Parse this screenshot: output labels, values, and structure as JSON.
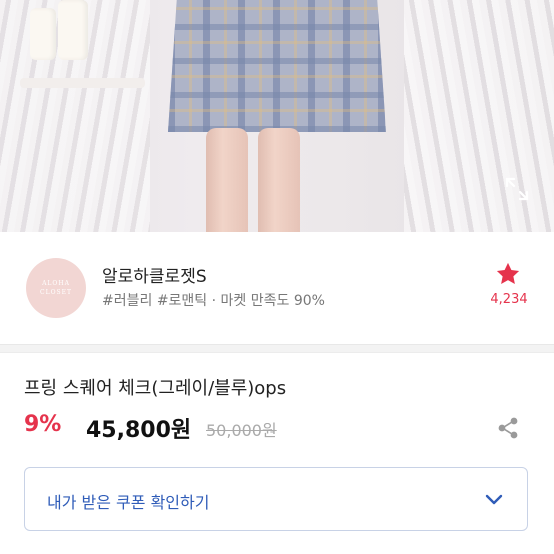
{
  "seller": {
    "name": "알로하클로젯S",
    "logo_text_line1": "ALOHA",
    "logo_text_line2": "CLOSET",
    "tags_meta": "#러블리 #로맨틱 · 마켓 만족도 90%",
    "like_count": "4,234",
    "star_color": "#e5334c"
  },
  "product": {
    "title": "프링 스퀘어 체크(그레이/블루)ops",
    "discount": "9%",
    "price": "45,800원",
    "original_price": "50,000원"
  },
  "coupon": {
    "label": "내가 받은 쿠폰 확인하기"
  },
  "icons": {
    "expand": "expand-icon",
    "star": "star-icon",
    "share": "share-icon",
    "chevron": "chevron-down-icon"
  }
}
